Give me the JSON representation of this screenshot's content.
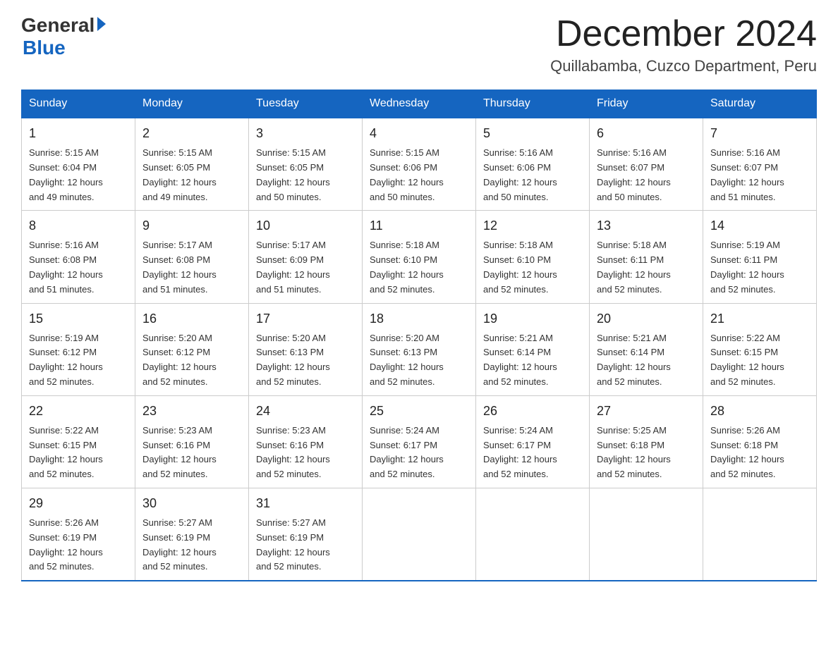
{
  "logo": {
    "general": "General",
    "blue": "Blue"
  },
  "header": {
    "month": "December 2024",
    "location": "Quillabamba, Cuzco Department, Peru"
  },
  "weekdays": [
    "Sunday",
    "Monday",
    "Tuesday",
    "Wednesday",
    "Thursday",
    "Friday",
    "Saturday"
  ],
  "weeks": [
    [
      {
        "day": "1",
        "sunrise": "5:15 AM",
        "sunset": "6:04 PM",
        "daylight": "12 hours and 49 minutes."
      },
      {
        "day": "2",
        "sunrise": "5:15 AM",
        "sunset": "6:05 PM",
        "daylight": "12 hours and 49 minutes."
      },
      {
        "day": "3",
        "sunrise": "5:15 AM",
        "sunset": "6:05 PM",
        "daylight": "12 hours and 50 minutes."
      },
      {
        "day": "4",
        "sunrise": "5:15 AM",
        "sunset": "6:06 PM",
        "daylight": "12 hours and 50 minutes."
      },
      {
        "day": "5",
        "sunrise": "5:16 AM",
        "sunset": "6:06 PM",
        "daylight": "12 hours and 50 minutes."
      },
      {
        "day": "6",
        "sunrise": "5:16 AM",
        "sunset": "6:07 PM",
        "daylight": "12 hours and 50 minutes."
      },
      {
        "day": "7",
        "sunrise": "5:16 AM",
        "sunset": "6:07 PM",
        "daylight": "12 hours and 51 minutes."
      }
    ],
    [
      {
        "day": "8",
        "sunrise": "5:16 AM",
        "sunset": "6:08 PM",
        "daylight": "12 hours and 51 minutes."
      },
      {
        "day": "9",
        "sunrise": "5:17 AM",
        "sunset": "6:08 PM",
        "daylight": "12 hours and 51 minutes."
      },
      {
        "day": "10",
        "sunrise": "5:17 AM",
        "sunset": "6:09 PM",
        "daylight": "12 hours and 51 minutes."
      },
      {
        "day": "11",
        "sunrise": "5:18 AM",
        "sunset": "6:10 PM",
        "daylight": "12 hours and 52 minutes."
      },
      {
        "day": "12",
        "sunrise": "5:18 AM",
        "sunset": "6:10 PM",
        "daylight": "12 hours and 52 minutes."
      },
      {
        "day": "13",
        "sunrise": "5:18 AM",
        "sunset": "6:11 PM",
        "daylight": "12 hours and 52 minutes."
      },
      {
        "day": "14",
        "sunrise": "5:19 AM",
        "sunset": "6:11 PM",
        "daylight": "12 hours and 52 minutes."
      }
    ],
    [
      {
        "day": "15",
        "sunrise": "5:19 AM",
        "sunset": "6:12 PM",
        "daylight": "12 hours and 52 minutes."
      },
      {
        "day": "16",
        "sunrise": "5:20 AM",
        "sunset": "6:12 PM",
        "daylight": "12 hours and 52 minutes."
      },
      {
        "day": "17",
        "sunrise": "5:20 AM",
        "sunset": "6:13 PM",
        "daylight": "12 hours and 52 minutes."
      },
      {
        "day": "18",
        "sunrise": "5:20 AM",
        "sunset": "6:13 PM",
        "daylight": "12 hours and 52 minutes."
      },
      {
        "day": "19",
        "sunrise": "5:21 AM",
        "sunset": "6:14 PM",
        "daylight": "12 hours and 52 minutes."
      },
      {
        "day": "20",
        "sunrise": "5:21 AM",
        "sunset": "6:14 PM",
        "daylight": "12 hours and 52 minutes."
      },
      {
        "day": "21",
        "sunrise": "5:22 AM",
        "sunset": "6:15 PM",
        "daylight": "12 hours and 52 minutes."
      }
    ],
    [
      {
        "day": "22",
        "sunrise": "5:22 AM",
        "sunset": "6:15 PM",
        "daylight": "12 hours and 52 minutes."
      },
      {
        "day": "23",
        "sunrise": "5:23 AM",
        "sunset": "6:16 PM",
        "daylight": "12 hours and 52 minutes."
      },
      {
        "day": "24",
        "sunrise": "5:23 AM",
        "sunset": "6:16 PM",
        "daylight": "12 hours and 52 minutes."
      },
      {
        "day": "25",
        "sunrise": "5:24 AM",
        "sunset": "6:17 PM",
        "daylight": "12 hours and 52 minutes."
      },
      {
        "day": "26",
        "sunrise": "5:24 AM",
        "sunset": "6:17 PM",
        "daylight": "12 hours and 52 minutes."
      },
      {
        "day": "27",
        "sunrise": "5:25 AM",
        "sunset": "6:18 PM",
        "daylight": "12 hours and 52 minutes."
      },
      {
        "day": "28",
        "sunrise": "5:26 AM",
        "sunset": "6:18 PM",
        "daylight": "12 hours and 52 minutes."
      }
    ],
    [
      {
        "day": "29",
        "sunrise": "5:26 AM",
        "sunset": "6:19 PM",
        "daylight": "12 hours and 52 minutes."
      },
      {
        "day": "30",
        "sunrise": "5:27 AM",
        "sunset": "6:19 PM",
        "daylight": "12 hours and 52 minutes."
      },
      {
        "day": "31",
        "sunrise": "5:27 AM",
        "sunset": "6:19 PM",
        "daylight": "12 hours and 52 minutes."
      },
      null,
      null,
      null,
      null
    ]
  ],
  "labels": {
    "sunrise": "Sunrise:",
    "sunset": "Sunset:",
    "daylight": "Daylight:"
  }
}
